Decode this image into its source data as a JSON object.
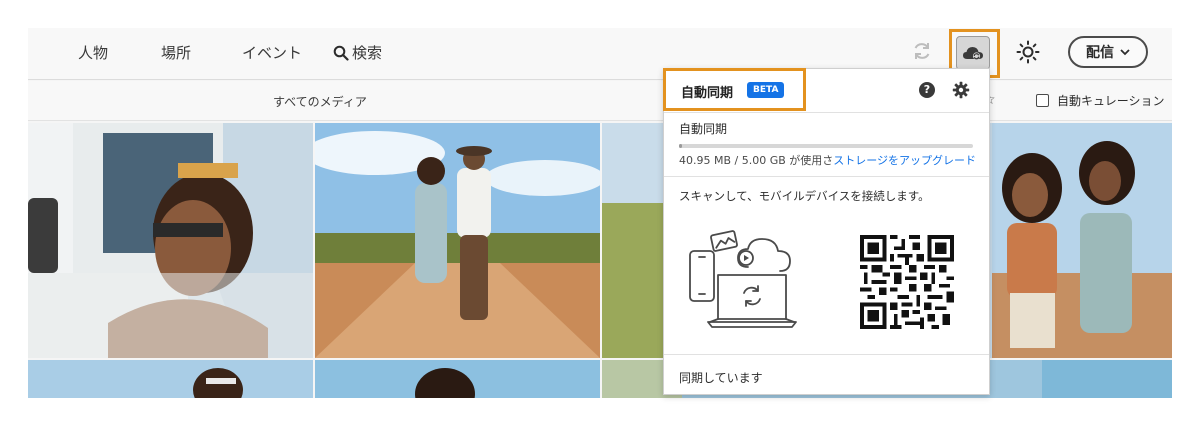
{
  "nav": {
    "people": "人物",
    "places": "場所",
    "events": "イベント",
    "search": "検索"
  },
  "toolbar": {
    "share_label": "配信",
    "sync_icon": "refresh-icon",
    "cloud_icon": "cloud-sync-icon",
    "brightness_icon": "sun-icon"
  },
  "subbar": {
    "all_media": "すべてのメディア",
    "auto_curation": "自動キュレーション",
    "auto_curation_checked": false
  },
  "popover": {
    "title": "自動同期",
    "badge": "BETA",
    "section_label": "自動同期",
    "storage_used": "40.95 MB / 5.00 GB が使用さ",
    "upgrade_link": "ストレージをアップグレード",
    "storage_fraction": 0.008,
    "scan_text": "スキャンして、モバイルデバイスを接続します。",
    "status": "同期しています",
    "help_icon": "help-icon",
    "settings_icon": "gear-icon"
  },
  "colors": {
    "accent": "#1473e6",
    "highlight": "#e3921f"
  }
}
